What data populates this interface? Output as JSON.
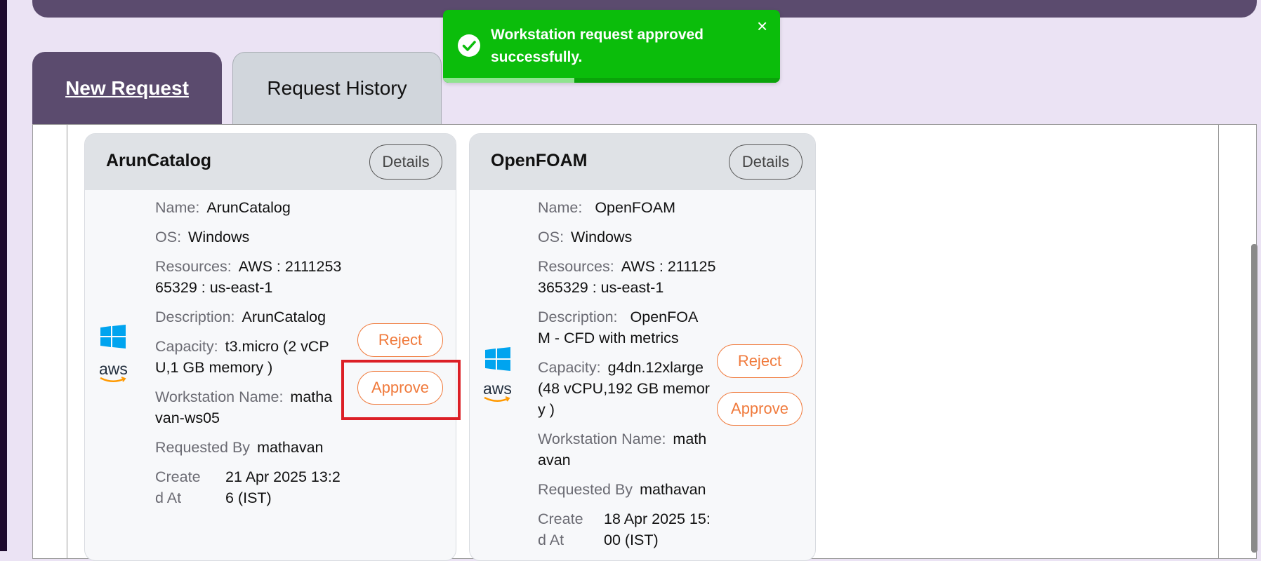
{
  "tabs": [
    {
      "label": "New Request",
      "active": true
    },
    {
      "label": "Request History",
      "active": false
    }
  ],
  "toast": {
    "message": "Workstation request approved successfully.",
    "close_glyph": "×",
    "icon": "check-circle-icon",
    "progress": 0.39,
    "color": "#0bbd0b"
  },
  "labels": {
    "name": "Name:",
    "os": "OS:",
    "resources": "Resources:",
    "description": "Description:",
    "capacity": "Capacity:",
    "workstation_name": "Workstation Name:",
    "requested_by": "Requested By",
    "created_at_1": "Create",
    "created_at_2": "d At"
  },
  "buttons": {
    "details": "Details",
    "reject": "Reject",
    "approve": "Approve"
  },
  "cards": [
    {
      "title": "ArunCatalog",
      "os_icon": "windows-icon",
      "provider_icon": "aws-icon",
      "provider_text": "aws",
      "name": "ArunCatalog",
      "os": "Windows",
      "resources_1": "AWS : 2111253",
      "resources_2": "65329 : us-east-1",
      "description_1": "ArunCatalog",
      "capacity_1": "t3.micro  (2 vCP",
      "capacity_2": "U,1 GB memory )",
      "workstation_1": "matha",
      "workstation_2": "van-ws05",
      "requested_by": "mathavan",
      "created_1": "21 Apr 2025 13:2",
      "created_2": "6  (IST)"
    },
    {
      "title": "OpenFOAM",
      "os_icon": "windows-icon",
      "provider_icon": "aws-icon",
      "provider_text": "aws",
      "name": "OpenFOAM",
      "os": "Windows",
      "resources_1": "AWS : 211125",
      "resources_2": "365329 : us-east-1",
      "description_1": "OpenFOA",
      "description_2": "M - CFD with metrics",
      "capacity_1": "g4dn.12xlarge",
      "capacity_2": " (48 vCPU,192 GB memor",
      "capacity_3": "y )",
      "workstation_1": "math",
      "workstation_2": "avan",
      "requested_by": "mathavan",
      "created_1": "18 Apr 2025 15:",
      "created_2": "00  (IST)"
    }
  ],
  "colors": {
    "accent_purple": "#5b4b6e",
    "action_orange": "#f07a3c",
    "highlight_red": "#dc1f26",
    "windows_blue": "#00a4ef",
    "aws_orange": "#ff9900"
  }
}
